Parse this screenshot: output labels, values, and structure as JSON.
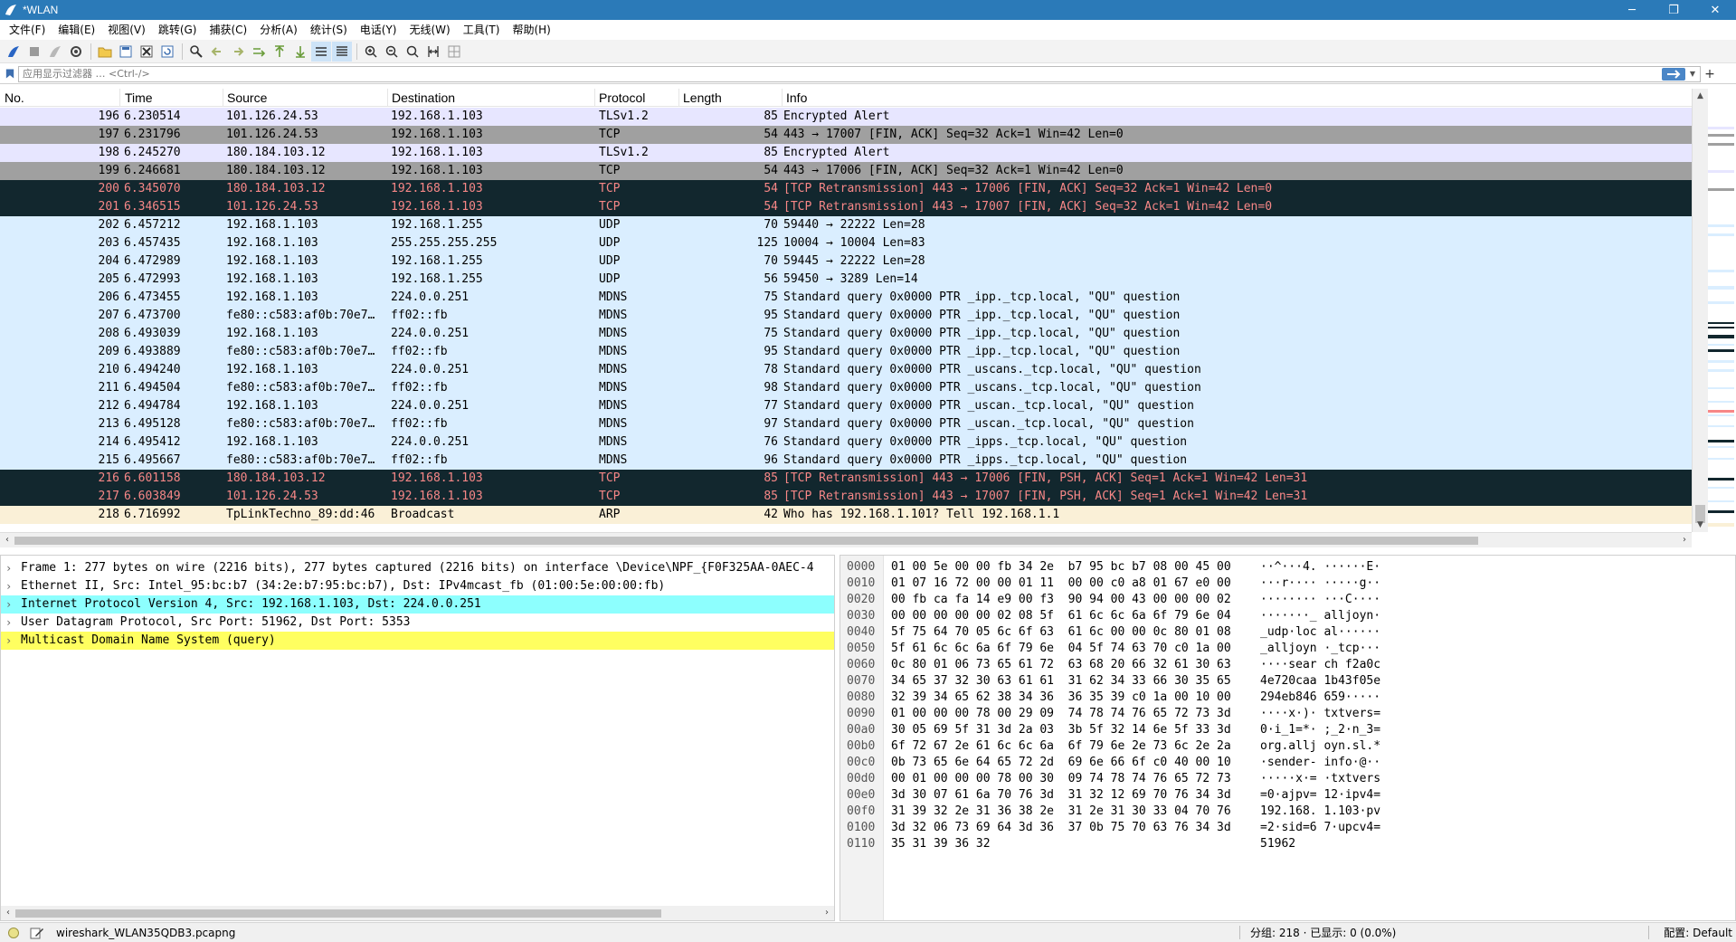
{
  "window": {
    "title": "*WLAN",
    "minimize": "─",
    "maximize": "❐",
    "close": "✕"
  },
  "menu": [
    "文件(F)",
    "编辑(E)",
    "视图(V)",
    "跳转(G)",
    "捕获(C)",
    "分析(A)",
    "统计(S)",
    "电话(Y)",
    "无线(W)",
    "工具(T)",
    "帮助(H)"
  ],
  "filter": {
    "placeholder": "应用显示过滤器 … <Ctrl-/>",
    "plus": "+"
  },
  "columns": [
    "No.",
    "Time",
    "Source",
    "Destination",
    "Protocol",
    "Length",
    "Info"
  ],
  "colors": {
    "tls": "#e7e6ff",
    "tcp_fin": "#a0a0a0",
    "bad": "#12272e",
    "bad_text": "#f78787",
    "udp": "#daeeff",
    "arp": "#faf0d7",
    "ipv4_sel": "#8dfffe",
    "mdns_sel": "#ffff60"
  },
  "packets": [
    {
      "no": "196",
      "time": "6.230514",
      "src": "101.126.24.53",
      "dst": "192.168.1.103",
      "proto": "TLSv1.2",
      "len": "85",
      "info": "Encrypted Alert",
      "style": "tls"
    },
    {
      "no": "197",
      "time": "6.231796",
      "src": "101.126.24.53",
      "dst": "192.168.1.103",
      "proto": "TCP",
      "len": "54",
      "info": "443 → 17007 [FIN, ACK] Seq=32 Ack=1 Win=42 Len=0",
      "style": "tcp_fin"
    },
    {
      "no": "198",
      "time": "6.245270",
      "src": "180.184.103.12",
      "dst": "192.168.1.103",
      "proto": "TLSv1.2",
      "len": "85",
      "info": "Encrypted Alert",
      "style": "tls"
    },
    {
      "no": "199",
      "time": "6.246681",
      "src": "180.184.103.12",
      "dst": "192.168.1.103",
      "proto": "TCP",
      "len": "54",
      "info": "443 → 17006 [FIN, ACK] Seq=32 Ack=1 Win=42 Len=0",
      "style": "tcp_fin"
    },
    {
      "no": "200",
      "time": "6.345070",
      "src": "180.184.103.12",
      "dst": "192.168.1.103",
      "proto": "TCP",
      "len": "54",
      "info": "[TCP Retransmission] 443 → 17006 [FIN, ACK] Seq=32 Ack=1 Win=42 Len=0",
      "style": "bad"
    },
    {
      "no": "201",
      "time": "6.346515",
      "src": "101.126.24.53",
      "dst": "192.168.1.103",
      "proto": "TCP",
      "len": "54",
      "info": "[TCP Retransmission] 443 → 17007 [FIN, ACK] Seq=32 Ack=1 Win=42 Len=0",
      "style": "bad"
    },
    {
      "no": "202",
      "time": "6.457212",
      "src": "192.168.1.103",
      "dst": "192.168.1.255",
      "proto": "UDP",
      "len": "70",
      "info": "59440 → 22222 Len=28",
      "style": "udp"
    },
    {
      "no": "203",
      "time": "6.457435",
      "src": "192.168.1.103",
      "dst": "255.255.255.255",
      "proto": "UDP",
      "len": "125",
      "info": "10004 → 10004 Len=83",
      "style": "udp"
    },
    {
      "no": "204",
      "time": "6.472989",
      "src": "192.168.1.103",
      "dst": "192.168.1.255",
      "proto": "UDP",
      "len": "70",
      "info": "59445 → 22222 Len=28",
      "style": "udp"
    },
    {
      "no": "205",
      "time": "6.472993",
      "src": "192.168.1.103",
      "dst": "192.168.1.255",
      "proto": "UDP",
      "len": "56",
      "info": "59450 → 3289 Len=14",
      "style": "udp"
    },
    {
      "no": "206",
      "time": "6.473455",
      "src": "192.168.1.103",
      "dst": "224.0.0.251",
      "proto": "MDNS",
      "len": "75",
      "info": "Standard query 0x0000 PTR _ipp._tcp.local, \"QU\" question",
      "style": "udp"
    },
    {
      "no": "207",
      "time": "6.473700",
      "src": "fe80::c583:af0b:70e7…",
      "dst": "ff02::fb",
      "proto": "MDNS",
      "len": "95",
      "info": "Standard query 0x0000 PTR _ipp._tcp.local, \"QU\" question",
      "style": "udp"
    },
    {
      "no": "208",
      "time": "6.493039",
      "src": "192.168.1.103",
      "dst": "224.0.0.251",
      "proto": "MDNS",
      "len": "75",
      "info": "Standard query 0x0000 PTR _ipp._tcp.local, \"QU\" question",
      "style": "udp"
    },
    {
      "no": "209",
      "time": "6.493889",
      "src": "fe80::c583:af0b:70e7…",
      "dst": "ff02::fb",
      "proto": "MDNS",
      "len": "95",
      "info": "Standard query 0x0000 PTR _ipp._tcp.local, \"QU\" question",
      "style": "udp"
    },
    {
      "no": "210",
      "time": "6.494240",
      "src": "192.168.1.103",
      "dst": "224.0.0.251",
      "proto": "MDNS",
      "len": "78",
      "info": "Standard query 0x0000 PTR _uscans._tcp.local, \"QU\" question",
      "style": "udp"
    },
    {
      "no": "211",
      "time": "6.494504",
      "src": "fe80::c583:af0b:70e7…",
      "dst": "ff02::fb",
      "proto": "MDNS",
      "len": "98",
      "info": "Standard query 0x0000 PTR _uscans._tcp.local, \"QU\" question",
      "style": "udp"
    },
    {
      "no": "212",
      "time": "6.494784",
      "src": "192.168.1.103",
      "dst": "224.0.0.251",
      "proto": "MDNS",
      "len": "77",
      "info": "Standard query 0x0000 PTR _uscan._tcp.local, \"QU\" question",
      "style": "udp"
    },
    {
      "no": "213",
      "time": "6.495128",
      "src": "fe80::c583:af0b:70e7…",
      "dst": "ff02::fb",
      "proto": "MDNS",
      "len": "97",
      "info": "Standard query 0x0000 PTR _uscan._tcp.local, \"QU\" question",
      "style": "udp"
    },
    {
      "no": "214",
      "time": "6.495412",
      "src": "192.168.1.103",
      "dst": "224.0.0.251",
      "proto": "MDNS",
      "len": "76",
      "info": "Standard query 0x0000 PTR _ipps._tcp.local, \"QU\" question",
      "style": "udp"
    },
    {
      "no": "215",
      "time": "6.495667",
      "src": "fe80::c583:af0b:70e7…",
      "dst": "ff02::fb",
      "proto": "MDNS",
      "len": "96",
      "info": "Standard query 0x0000 PTR _ipps._tcp.local, \"QU\" question",
      "style": "udp"
    },
    {
      "no": "216",
      "time": "6.601158",
      "src": "180.184.103.12",
      "dst": "192.168.1.103",
      "proto": "TCP",
      "len": "85",
      "info": "[TCP Retransmission] 443 → 17006 [FIN, PSH, ACK] Seq=1 Ack=1 Win=42 Len=31",
      "style": "bad"
    },
    {
      "no": "217",
      "time": "6.603849",
      "src": "101.126.24.53",
      "dst": "192.168.1.103",
      "proto": "TCP",
      "len": "85",
      "info": "[TCP Retransmission] 443 → 17007 [FIN, PSH, ACK] Seq=1 Ack=1 Win=42 Len=31",
      "style": "bad"
    },
    {
      "no": "218",
      "time": "6.716992",
      "src": "TpLinkTechno_89:dd:46",
      "dst": "Broadcast",
      "proto": "ARP",
      "len": "42",
      "info": "Who has 192.168.1.101? Tell 192.168.1.1",
      "style": "arp"
    }
  ],
  "details": [
    {
      "chev": "›",
      "text": "Frame 1: 277 bytes on wire (2216 bits), 277 bytes captured (2216 bits) on interface \\Device\\NPF_{F0F325AA-0AEC-4",
      "style": "none"
    },
    {
      "chev": "›",
      "text": "Ethernet II, Src: Intel_95:bc:b7 (34:2e:b7:95:bc:b7), Dst: IPv4mcast_fb (01:00:5e:00:00:fb)",
      "style": "none"
    },
    {
      "chev": "›",
      "text": "Internet Protocol Version 4, Src: 192.168.1.103, Dst: 224.0.0.251",
      "style": "ipv4_sel"
    },
    {
      "chev": "›",
      "text": "User Datagram Protocol, Src Port: 51962, Dst Port: 5353",
      "style": "none"
    },
    {
      "chev": "›",
      "text": "Multicast Domain Name System (query)",
      "style": "mdns_sel"
    }
  ],
  "bytes": [
    {
      "off": "0000",
      "hex": "01 00 5e 00 00 fb 34 2e  b7 95 bc b7 08 00 45 00",
      "asc": "··^···4. ······E·"
    },
    {
      "off": "0010",
      "hex": "01 07 16 72 00 00 01 11  00 00 c0 a8 01 67 e0 00",
      "asc": "···r···· ·····g··"
    },
    {
      "off": "0020",
      "hex": "00 fb ca fa 14 e9 00 f3  90 94 00 43 00 00 00 02",
      "asc": "········ ···C····"
    },
    {
      "off": "0030",
      "hex": "00 00 00 00 00 02 08 5f  61 6c 6c 6a 6f 79 6e 04",
      "asc": "·······_ alljoyn·"
    },
    {
      "off": "0040",
      "hex": "5f 75 64 70 05 6c 6f 63  61 6c 00 00 0c 80 01 08",
      "asc": "_udp·loc al······"
    },
    {
      "off": "0050",
      "hex": "5f 61 6c 6c 6a 6f 79 6e  04 5f 74 63 70 c0 1a 00",
      "asc": "_alljoyn ·_tcp···"
    },
    {
      "off": "0060",
      "hex": "0c 80 01 06 73 65 61 72  63 68 20 66 32 61 30 63",
      "asc": "····sear ch f2a0c"
    },
    {
      "off": "0070",
      "hex": "34 65 37 32 30 63 61 61  31 62 34 33 66 30 35 65",
      "asc": "4e720caa 1b43f05e"
    },
    {
      "off": "0080",
      "hex": "32 39 34 65 62 38 34 36  36 35 39 c0 1a 00 10 00",
      "asc": "294eb846 659·····"
    },
    {
      "off": "0090",
      "hex": "01 00 00 00 78 00 29 09  74 78 74 76 65 72 73 3d",
      "asc": "····x·)· txtvers="
    },
    {
      "off": "00a0",
      "hex": "30 05 69 5f 31 3d 2a 03  3b 5f 32 14 6e 5f 33 3d",
      "asc": "0·i_1=*· ;_2·n_3="
    },
    {
      "off": "00b0",
      "hex": "6f 72 67 2e 61 6c 6c 6a  6f 79 6e 2e 73 6c 2e 2a",
      "asc": "org.allj oyn.sl.*"
    },
    {
      "off": "00c0",
      "hex": "0b 73 65 6e 64 65 72 2d  69 6e 66 6f c0 40 00 10",
      "asc": "·sender- info·@··"
    },
    {
      "off": "00d0",
      "hex": "00 01 00 00 00 78 00 30  09 74 78 74 76 65 72 73",
      "asc": "·····x·= ·txtvers"
    },
    {
      "off": "00e0",
      "hex": "3d 30 07 61 6a 70 76 3d  31 32 12 69 70 76 34 3d",
      "asc": "=0·ajpv= 12·ipv4="
    },
    {
      "off": "00f0",
      "hex": "31 39 32 2e 31 36 38 2e  31 2e 31 30 33 04 70 76",
      "asc": "192.168. 1.103·pv"
    },
    {
      "off": "0100",
      "hex": "3d 32 06 73 69 64 3d 36  37 0b 75 70 63 76 34 3d",
      "asc": "=2·sid=6 7·upcv4="
    },
    {
      "off": "0110",
      "hex": "35 31 39 36 32",
      "asc": "51962"
    }
  ],
  "status": {
    "file": "wireshark_WLAN35QDB3.pcapng",
    "stats": "分组: 218 · 已显示: 0 (0.0%)",
    "profile": "配置: Default"
  }
}
